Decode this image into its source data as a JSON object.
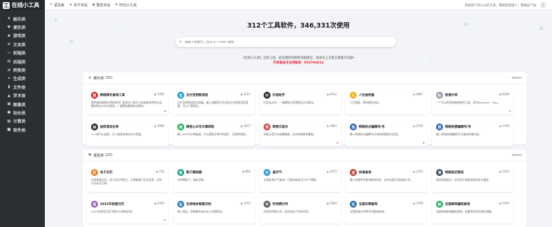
{
  "app": {
    "logo_mark": "工",
    "logo_text": "在线小工具"
  },
  "sidebar": {
    "items": [
      {
        "label": "娱乐类",
        "icon": "star-icon",
        "glyph": "★"
      },
      {
        "label": "便民类",
        "icon": "heart-icon",
        "glyph": "♥"
      },
      {
        "label": "游戏类",
        "icon": "gamepad-icon",
        "glyph": "◆"
      },
      {
        "label": "文本类",
        "icon": "text-icon",
        "glyph": "≡"
      },
      {
        "label": "前端类",
        "icon": "code-icon",
        "glyph": "‹›"
      },
      {
        "label": "后端类",
        "icon": "server-icon",
        "glyph": "▤"
      },
      {
        "label": "转换类",
        "icon": "exchange-icon",
        "glyph": "⇄"
      },
      {
        "label": "生成类",
        "icon": "magic-icon",
        "glyph": "✦"
      },
      {
        "label": "文件类",
        "icon": "file-icon",
        "glyph": "▮"
      },
      {
        "label": "学术类",
        "icon": "graduation-icon",
        "glyph": "▲"
      },
      {
        "label": "图像类",
        "icon": "image-icon",
        "glyph": "▣"
      },
      {
        "label": "站长类",
        "icon": "globe-icon",
        "glyph": "●"
      },
      {
        "label": "计算类",
        "icon": "calculator-icon",
        "glyph": "▦"
      },
      {
        "label": "软件类",
        "icon": "software-icon",
        "glyph": "■"
      }
    ]
  },
  "topbar": {
    "links": [
      {
        "label": "留言板",
        "icon": "message-icon",
        "glyph": "✎"
      },
      {
        "label": "关于本站",
        "icon": "info-icon",
        "glyph": "★"
      },
      {
        "label": "警告本站",
        "icon": "warning-icon",
        "glyph": "◆"
      },
      {
        "label": "时光小工具",
        "icon": "clock-icon",
        "glyph": "★"
      }
    ],
    "notice": "未找到了您心头的工具，我想还是给个，把相这个站",
    "toggle_icon": "moon-icon",
    "toggle_glyph": "☾"
  },
  "hero": {
    "title": "312个工具软件，346,331次使用",
    "search_placeholder": "请输入关键字，回车可 / Enter 搜索",
    "search_icon": "search-icon",
    "notice": "《在线小工具》全新上线，此前遇到问题和功能建议，请进去上方留言板提交问题~",
    "contact": "开发者技术支持联系：953766814"
  },
  "sections": [
    {
      "title": "娱乐类",
      "count": "(32)",
      "more": "more+",
      "icon": "star-icon",
      "cards": [
        {
          "title": "网络舆论查询工具",
          "views": "1765",
          "desc": "想知道网络舆论到底如何？使用本工具可以快速查询到热点话题的舆论方向与趋势，一键获取最新热点解析。",
          "icon_glyph": "舆",
          "icon_color": "#d9281f",
          "dot": "#e84c3d"
        },
        {
          "title": "支付宝到账语音",
          "views": "1327",
          "desc": "支付宝到账语音生成器，输入金额即可生成支付宝到账语音提醒，可以下载保存。",
          "icon_glyph": "支",
          "icon_color": "#1e9ad6",
          "dot": ""
        },
        {
          "title": "抖音助手",
          "views": "2612",
          "desc": "抖音去水印，一键提取抖音视频无水印版本。",
          "icon_glyph": "抖",
          "icon_color": "#222222",
          "dot": ""
        },
        {
          "title": "人生抽奖器",
          "views": "3887",
          "desc": "人生抽奖，帮你做出决定。",
          "icon_glyph": "人",
          "icon_color": "#f2b21b",
          "dot": ""
        },
        {
          "title": "检测大师",
          "views": "6309",
          "desc": "一个可以检测电脑性能的工具，支持Windows、Mac。",
          "icon_glyph": "检",
          "icon_color": "#8e9aa8",
          "dot": "#2ecc71"
        },
        {
          "title": "抽奖滚动名单",
          "views": "3060",
          "desc": "人人都可以抽奖，为人抽奖带来快乐与惊喜。",
          "icon_glyph": "抽",
          "icon_color": "#222222",
          "dot": ""
        },
        {
          "title": "微信公众号文章获取",
          "views": "1617",
          "desc": "输入公众号文章链接，可以提取文章中的图片、音频和视频。",
          "icon_glyph": "微",
          "icon_color": "#21b352",
          "dot": ""
        },
        {
          "title": "网易云音乐",
          "views": "1983",
          "desc": "网易云音乐外链播放器，支持单曲歌单播放。",
          "icon_glyph": "网",
          "icon_color": "#d63a33",
          "dot": "#e84c3d"
        },
        {
          "title": "网络热点编辑号/号",
          "views": "1556",
          "desc": "输入网络热点编辑号/号查询网络热点信息。",
          "icon_glyph": "热",
          "icon_color": "#2a63b8",
          "dot": "#2e86de"
        },
        {
          "title": "网络热搜编辑号/号",
          "views": "1376",
          "desc": "输入网络热搜编辑号/号查询热搜内容。",
          "icon_glyph": "搜",
          "icon_color": "#2a63b8",
          "dot": ""
        }
      ]
    },
    {
      "title": "便民类",
      "count": "(23)",
      "more": "more+",
      "icon": "heart-icon",
      "cards": [
        {
          "title": "电子日历",
          "views": "723",
          "desc": "在线查询日历，显示农历节假日，方便查看万年历信息，支持公历农历互转。",
          "icon_glyph": "历",
          "icon_color": "#e67e22",
          "dot": ""
        },
        {
          "title": "骰子模拟器",
          "views": "666",
          "desc": "在线掷骰子，随机点数。",
          "icon_glyph": "骰",
          "icon_color": "#16a085",
          "dot": ""
        },
        {
          "title": "查天气",
          "views": "1073",
          "desc": "全国各地天气查询，可查询未来几天天气预报。",
          "icon_glyph": "天",
          "icon_color": "#3498db",
          "dot": ""
        },
        {
          "title": "快递查询",
          "views": "1334",
          "desc": "输入快递单号查询物流信息，支持全国主流快递公司。",
          "icon_glyph": "递",
          "icon_color": "#c0392b",
          "dot": ""
        },
        {
          "title": "网络延迟测试",
          "views": "1352",
          "desc": "测试网络延迟，实时显示网络连接状态与速度。",
          "icon_glyph": "测",
          "icon_color": "#34495e",
          "dot": ""
        },
        {
          "title": "2022年放假日历",
          "views": "2263",
          "desc": "2022年国家法定节假日与调休安排。",
          "icon_glyph": "假",
          "icon_color": "#9b59b6",
          "dot": "#3498db"
        },
        {
          "title": "在线地址智能识别",
          "views": "1413",
          "desc": "输入地址，智能解析省市区与详细地址。",
          "icon_glyph": "址",
          "icon_color": "#2980b9",
          "dot": ""
        },
        {
          "title": "时间倒计时",
          "views": "1594",
          "desc": "在线时间倒计时，支持自定义目标时间。",
          "icon_glyph": "时",
          "icon_color": "#555555",
          "dot": ""
        },
        {
          "title": "全国车牌查询",
          "views": "1318",
          "desc": "全国各省市车牌号归属地查询。",
          "icon_glyph": "车",
          "icon_color": "#2471a3",
          "dot": ""
        },
        {
          "title": "全国邮政编码查询",
          "views": "1031",
          "desc": "全国各地邮政编码查询，快速找到目标地区邮编。",
          "icon_glyph": "邮",
          "icon_color": "#27ae60",
          "dot": ""
        }
      ]
    }
  ]
}
